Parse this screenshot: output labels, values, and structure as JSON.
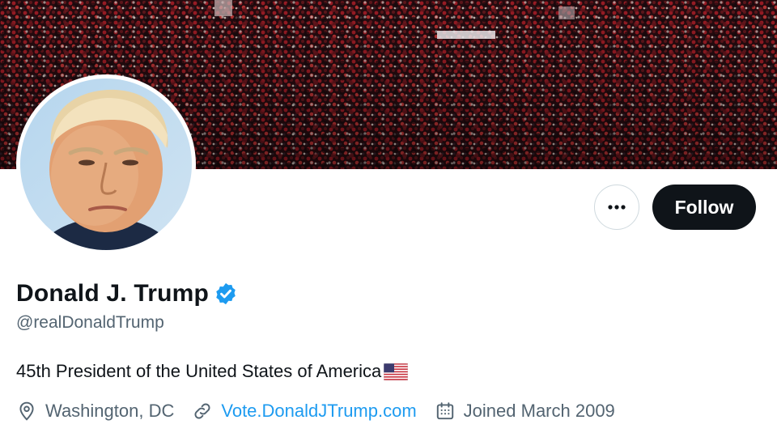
{
  "profile": {
    "name": "Donald J. Trump",
    "handle": "@realDonaldTrump",
    "bio": "45th President of the United States of America",
    "bio_emoji": "us-flag-icon",
    "verified": true,
    "location": "Washington, DC",
    "website": "Vote.DonaldJTrump.com",
    "joined": "Joined March 2009"
  },
  "actions": {
    "follow_label": "Follow",
    "more_icon": "more-options-icon"
  },
  "colors": {
    "accent": "#1d9bf0",
    "text_primary": "#0f1419",
    "text_secondary": "#536471",
    "button_dark": "#0f1419"
  }
}
